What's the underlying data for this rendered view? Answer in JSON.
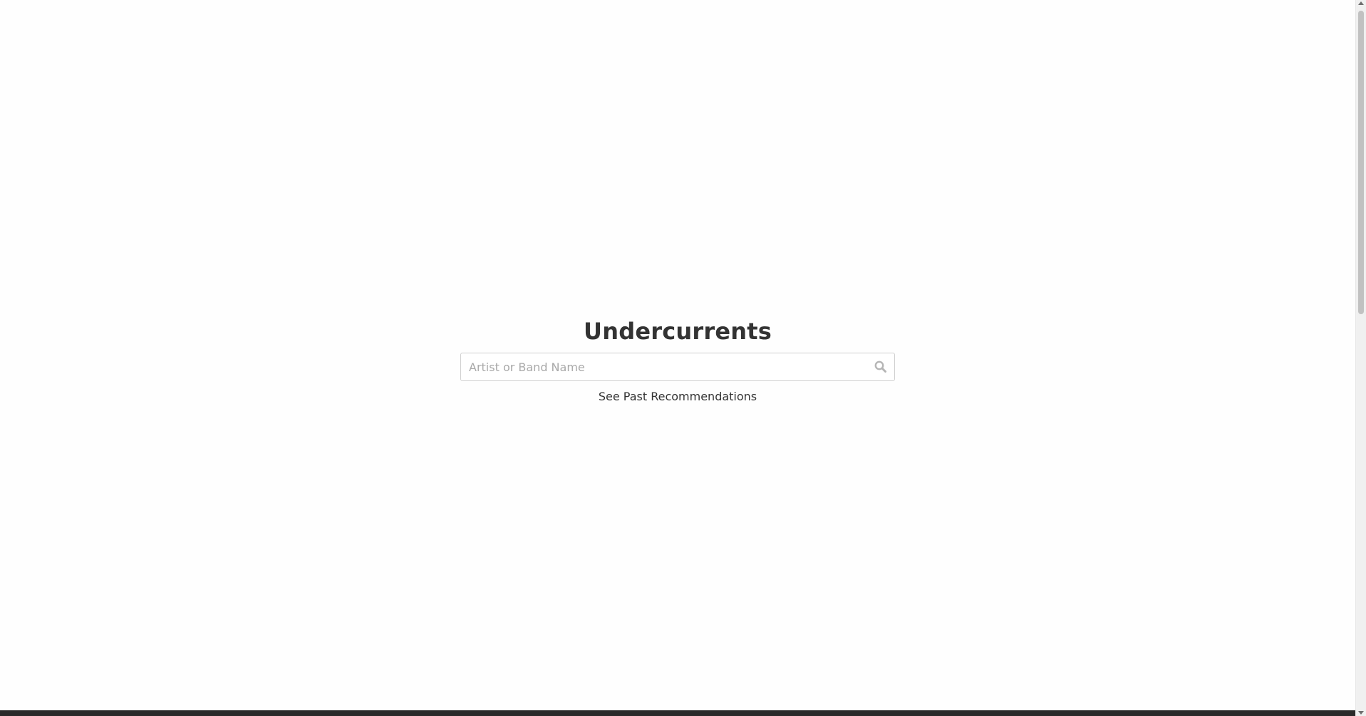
{
  "app": {
    "title": "Undercurrents"
  },
  "search": {
    "placeholder": "Artist or Band Name",
    "value": "",
    "icon": "search-icon"
  },
  "links": {
    "past_recommendations": "See Past Recommendations"
  },
  "colors": {
    "background": "#fefefe",
    "text": "#333333",
    "placeholder": "#a9a9a9",
    "input_border": "#cfcfcf",
    "bottom_bar": "#2a2a2a"
  }
}
